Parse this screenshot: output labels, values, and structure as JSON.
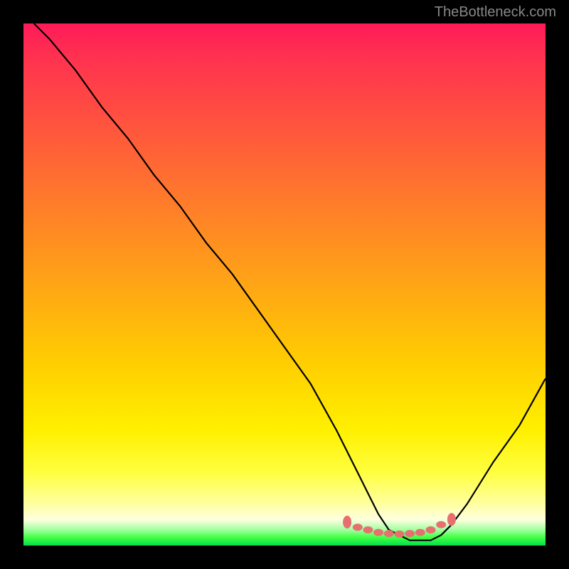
{
  "watermark": "TheBottleneck.com",
  "chart_data": {
    "type": "line",
    "title": "",
    "xlabel": "",
    "ylabel": "",
    "xlim": [
      0,
      100
    ],
    "ylim": [
      0,
      100
    ],
    "series": [
      {
        "name": "bottleneck-curve",
        "x": [
          2,
          5,
          10,
          15,
          20,
          25,
          30,
          35,
          40,
          45,
          50,
          55,
          60,
          62,
          64,
          66,
          68,
          70,
          72,
          74,
          76,
          78,
          80,
          82,
          85,
          90,
          95,
          100
        ],
        "y": [
          100,
          97,
          91,
          84,
          78,
          71,
          65,
          58,
          52,
          45,
          38,
          31,
          22,
          18,
          14,
          10,
          6,
          3,
          2,
          1,
          1,
          1,
          2,
          4,
          8,
          16,
          23,
          32
        ]
      }
    ],
    "markers": {
      "name": "highlight-dots",
      "color": "#e67070",
      "points": [
        {
          "x": 62,
          "y": 4.5
        },
        {
          "x": 64,
          "y": 3.5
        },
        {
          "x": 66,
          "y": 3.0
        },
        {
          "x": 68,
          "y": 2.5
        },
        {
          "x": 70,
          "y": 2.3
        },
        {
          "x": 72,
          "y": 2.2
        },
        {
          "x": 74,
          "y": 2.3
        },
        {
          "x": 76,
          "y": 2.5
        },
        {
          "x": 78,
          "y": 3.0
        },
        {
          "x": 80,
          "y": 4.0
        },
        {
          "x": 82,
          "y": 5.0
        }
      ]
    },
    "gradient_stops": [
      {
        "pos": 0,
        "color": "#ff1a58"
      },
      {
        "pos": 50,
        "color": "#ffc000"
      },
      {
        "pos": 90,
        "color": "#ffff80"
      },
      {
        "pos": 100,
        "color": "#00e050"
      }
    ]
  }
}
